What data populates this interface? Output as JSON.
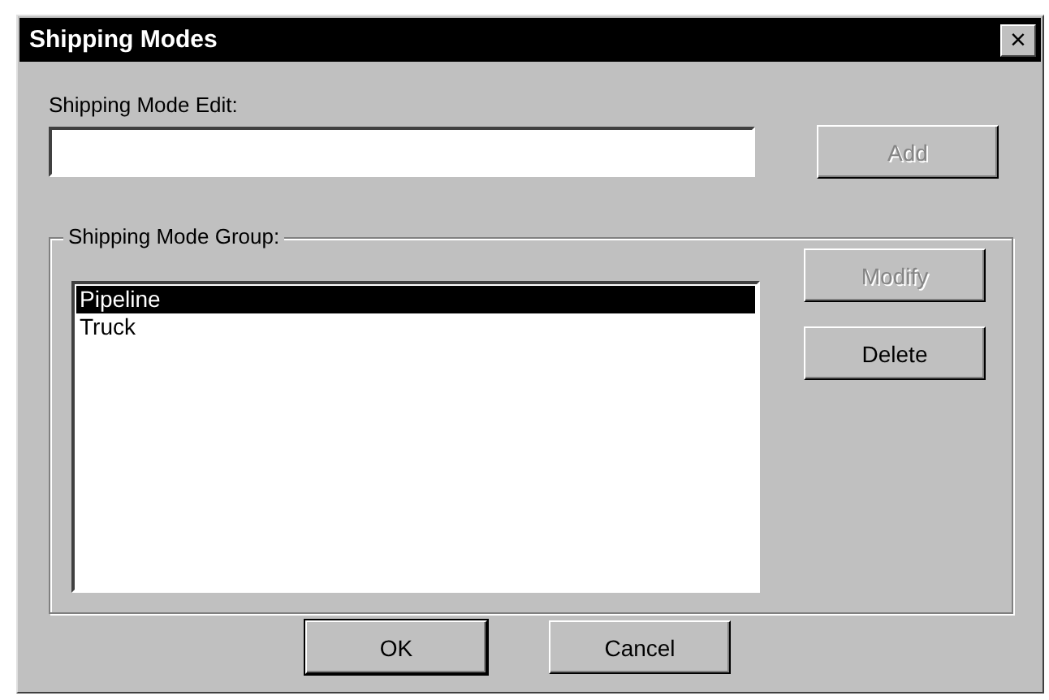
{
  "window": {
    "title": "Shipping Modes",
    "close": "×"
  },
  "edit": {
    "label": "Shipping Mode Edit:"
  },
  "add_button": {
    "label": "Add",
    "disabled": true
  },
  "group": {
    "title": "Shipping Mode Group:"
  },
  "list": [
    {
      "label": "Pipeline",
      "selected": true
    },
    {
      "label": "Truck",
      "selected": false
    }
  ],
  "side_buttons": [
    {
      "label": "Modify",
      "disabled": true
    },
    {
      "label": "Delete",
      "disabled": false
    }
  ],
  "buttons": [
    {
      "label": "OK",
      "default": true
    },
    {
      "label": "Cancel",
      "default": false
    }
  ]
}
